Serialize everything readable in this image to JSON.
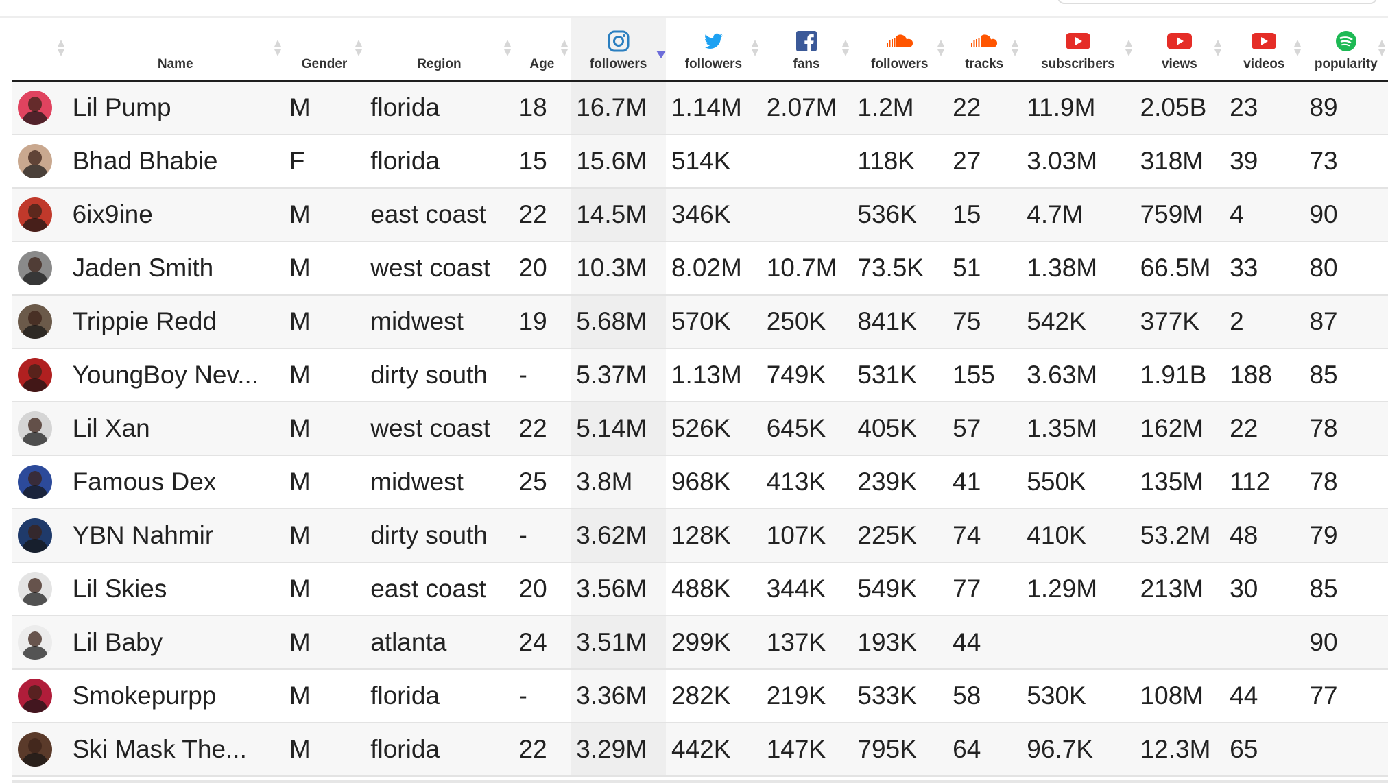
{
  "columns": [
    {
      "key": "avatar",
      "label": "",
      "icon": ""
    },
    {
      "key": "name",
      "label": "Name",
      "icon": ""
    },
    {
      "key": "gender",
      "label": "Gender",
      "icon": ""
    },
    {
      "key": "region",
      "label": "Region",
      "icon": ""
    },
    {
      "key": "age",
      "label": "Age",
      "icon": ""
    },
    {
      "key": "ig_followers",
      "label": "followers",
      "icon": "instagram-icon",
      "sorted": "descending"
    },
    {
      "key": "tw_followers",
      "label": "followers",
      "icon": "twitter-icon"
    },
    {
      "key": "fb_fans",
      "label": "fans",
      "icon": "facebook-icon"
    },
    {
      "key": "sc_followers",
      "label": "followers",
      "icon": "soundcloud-icon"
    },
    {
      "key": "sc_tracks",
      "label": "tracks",
      "icon": "soundcloud-icon"
    },
    {
      "key": "yt_subscribers",
      "label": "subscribers",
      "icon": "youtube-icon"
    },
    {
      "key": "yt_views",
      "label": "views",
      "icon": "youtube-icon"
    },
    {
      "key": "yt_videos",
      "label": "videos",
      "icon": "youtube-icon"
    },
    {
      "key": "sp_popularity",
      "label": "popularity",
      "icon": "spotify-icon"
    }
  ],
  "colors": {
    "instagram": "#2b7fc0",
    "twitter": "#1da1f2",
    "facebook": "#3b5998",
    "soundcloud": "#ff5500",
    "youtube": "#e52d27",
    "spotify": "#1db954",
    "sort_indicator": "#6d6dd9"
  },
  "rows": [
    {
      "name": "Lil Pump",
      "gender": "M",
      "region": "florida",
      "age": "18",
      "ig_followers": "16.7M",
      "tw_followers": "1.14M",
      "fb_fans": "2.07M",
      "sc_followers": "1.2M",
      "sc_tracks": "22",
      "yt_subscribers": "11.9M",
      "yt_views": "2.05B",
      "yt_videos": "23",
      "sp_popularity": "89",
      "avatar_color": "#e0435f"
    },
    {
      "name": "Bhad Bhabie",
      "gender": "F",
      "region": "florida",
      "age": "15",
      "ig_followers": "15.6M",
      "tw_followers": "514K",
      "fb_fans": "",
      "sc_followers": "118K",
      "sc_tracks": "27",
      "yt_subscribers": "3.03M",
      "yt_views": "318M",
      "yt_videos": "39",
      "sp_popularity": "73",
      "avatar_color": "#c9a88f"
    },
    {
      "name": "6ix9ine",
      "gender": "M",
      "region": "east coast",
      "age": "22",
      "ig_followers": "14.5M",
      "tw_followers": "346K",
      "fb_fans": "",
      "sc_followers": "536K",
      "sc_tracks": "15",
      "yt_subscribers": "4.7M",
      "yt_views": "759M",
      "yt_videos": "4",
      "sp_popularity": "90",
      "avatar_color": "#c0392b"
    },
    {
      "name": "Jaden Smith",
      "gender": "M",
      "region": "west coast",
      "age": "20",
      "ig_followers": "10.3M",
      "tw_followers": "8.02M",
      "fb_fans": "10.7M",
      "sc_followers": "73.5K",
      "sc_tracks": "51",
      "yt_subscribers": "1.38M",
      "yt_views": "66.5M",
      "yt_videos": "33",
      "sp_popularity": "80",
      "avatar_color": "#8a8a8a"
    },
    {
      "name": "Trippie Redd",
      "gender": "M",
      "region": "midwest",
      "age": "19",
      "ig_followers": "5.68M",
      "tw_followers": "570K",
      "fb_fans": "250K",
      "sc_followers": "841K",
      "sc_tracks": "75",
      "yt_subscribers": "542K",
      "yt_views": "377K",
      "yt_videos": "2",
      "sp_popularity": "87",
      "avatar_color": "#6b5a4a"
    },
    {
      "name": "YoungBoy Nev...",
      "gender": "M",
      "region": "dirty south",
      "age": "-",
      "ig_followers": "5.37M",
      "tw_followers": "1.13M",
      "fb_fans": "749K",
      "sc_followers": "531K",
      "sc_tracks": "155",
      "yt_subscribers": "3.63M",
      "yt_views": "1.91B",
      "yt_videos": "188",
      "sp_popularity": "85",
      "avatar_color": "#b02020"
    },
    {
      "name": "Lil Xan",
      "gender": "M",
      "region": "west coast",
      "age": "22",
      "ig_followers": "5.14M",
      "tw_followers": "526K",
      "fb_fans": "645K",
      "sc_followers": "405K",
      "sc_tracks": "57",
      "yt_subscribers": "1.35M",
      "yt_views": "162M",
      "yt_videos": "22",
      "sp_popularity": "78",
      "avatar_color": "#d5d5d5"
    },
    {
      "name": "Famous Dex",
      "gender": "M",
      "region": "midwest",
      "age": "25",
      "ig_followers": "3.8M",
      "tw_followers": "968K",
      "fb_fans": "413K",
      "sc_followers": "239K",
      "sc_tracks": "41",
      "yt_subscribers": "550K",
      "yt_views": "135M",
      "yt_videos": "112",
      "sp_popularity": "78",
      "avatar_color": "#2c4a9a"
    },
    {
      "name": "YBN Nahmir",
      "gender": "M",
      "region": "dirty south",
      "age": "-",
      "ig_followers": "3.62M",
      "tw_followers": "128K",
      "fb_fans": "107K",
      "sc_followers": "225K",
      "sc_tracks": "74",
      "yt_subscribers": "410K",
      "yt_views": "53.2M",
      "yt_videos": "48",
      "sp_popularity": "79",
      "avatar_color": "#1f3a6a"
    },
    {
      "name": "Lil Skies",
      "gender": "M",
      "region": "east coast",
      "age": "20",
      "ig_followers": "3.56M",
      "tw_followers": "488K",
      "fb_fans": "344K",
      "sc_followers": "549K",
      "sc_tracks": "77",
      "yt_subscribers": "1.29M",
      "yt_views": "213M",
      "yt_videos": "30",
      "sp_popularity": "85",
      "avatar_color": "#e4e4e4"
    },
    {
      "name": "Lil Baby",
      "gender": "M",
      "region": "atlanta",
      "age": "24",
      "ig_followers": "3.51M",
      "tw_followers": "299K",
      "fb_fans": "137K",
      "sc_followers": "193K",
      "sc_tracks": "44",
      "yt_subscribers": "",
      "yt_views": "",
      "yt_videos": "",
      "sp_popularity": "90",
      "avatar_color": "#ececec"
    },
    {
      "name": "Smokepurpp",
      "gender": "M",
      "region": "florida",
      "age": "-",
      "ig_followers": "3.36M",
      "tw_followers": "282K",
      "fb_fans": "219K",
      "sc_followers": "533K",
      "sc_tracks": "58",
      "yt_subscribers": "530K",
      "yt_views": "108M",
      "yt_videos": "44",
      "sp_popularity": "77",
      "avatar_color": "#b01d3a"
    },
    {
      "name": "Ski Mask The...",
      "gender": "M",
      "region": "florida",
      "age": "22",
      "ig_followers": "3.29M",
      "tw_followers": "442K",
      "fb_fans": "147K",
      "sc_followers": "795K",
      "sc_tracks": "64",
      "yt_subscribers": "96.7K",
      "yt_views": "12.3M",
      "yt_videos": "65",
      "sp_popularity": "",
      "avatar_color": "#5a3a2a"
    }
  ]
}
